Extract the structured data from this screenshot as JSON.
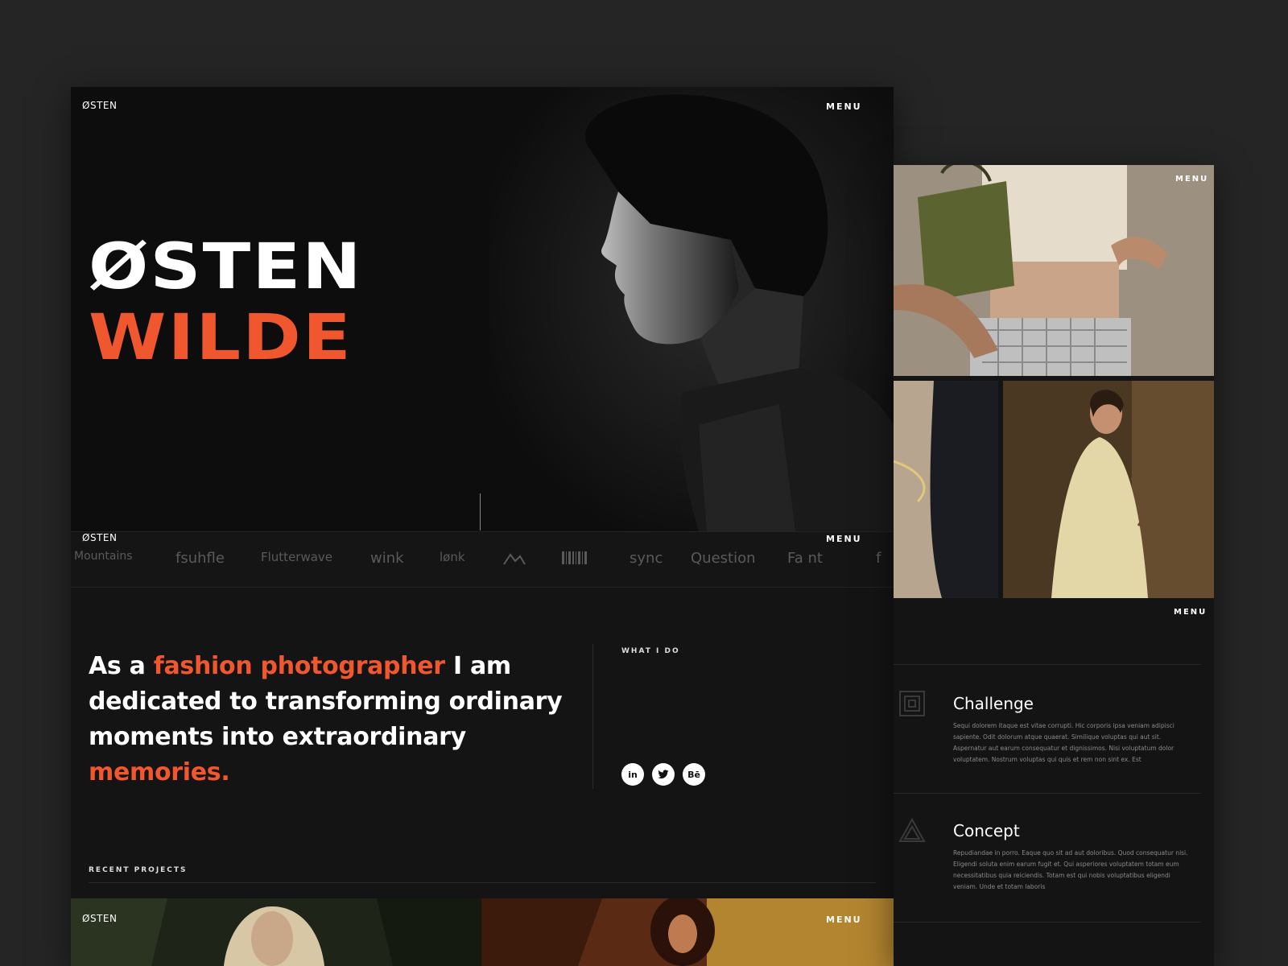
{
  "brand": {
    "logo": "ØSTEN",
    "menu_label": "MENU",
    "first_name": "ØSTEN",
    "last_name": "WILDE",
    "accent_color": "#f0572e"
  },
  "clients": [
    "Mountains",
    "fsuhfle",
    "Flutterwave",
    "wink",
    "lønk",
    "",
    "",
    "sync",
    "Question",
    "Fa  nt",
    "f"
  ],
  "about": {
    "part1": "As a ",
    "accent1": "fashion photographer",
    "part2": " I am dedicated to transforming ordinary moments into extraordinary ",
    "accent2": "memories.",
    "what_i_do_label": "WHAT I DO",
    "socials": [
      "in",
      "t",
      "Bē"
    ]
  },
  "recent": {
    "label": "RECENT PROJECTS"
  },
  "side": {
    "menu_label": "MENU",
    "steps": [
      {
        "title": "Challenge",
        "body": "Sequi dolorem itaque est vitae corrupti. Hic corporis ipsa veniam adipisci sapiente. Odit dolorum atque quaerat. Similique voluptas qui aut sit. Aspernatur aut earum consequatur et dignissimos. Nisi voluptatum dolor voluptatem. Nostrum voluptas qui quis et rem non sint ex. Est"
      },
      {
        "title": "Concept",
        "body": "Repudiandae in porro. Eaque quo sit ad aut doloribus. Quod consequatur nisi. Eligendi soluta enim earum fugit et. Qui asperiores voluptatem totam eum necessitatibus quia reiciendis. Totam est qui nobis voluptatibus eligendi veniam. Unde et totam laboris"
      }
    ]
  }
}
